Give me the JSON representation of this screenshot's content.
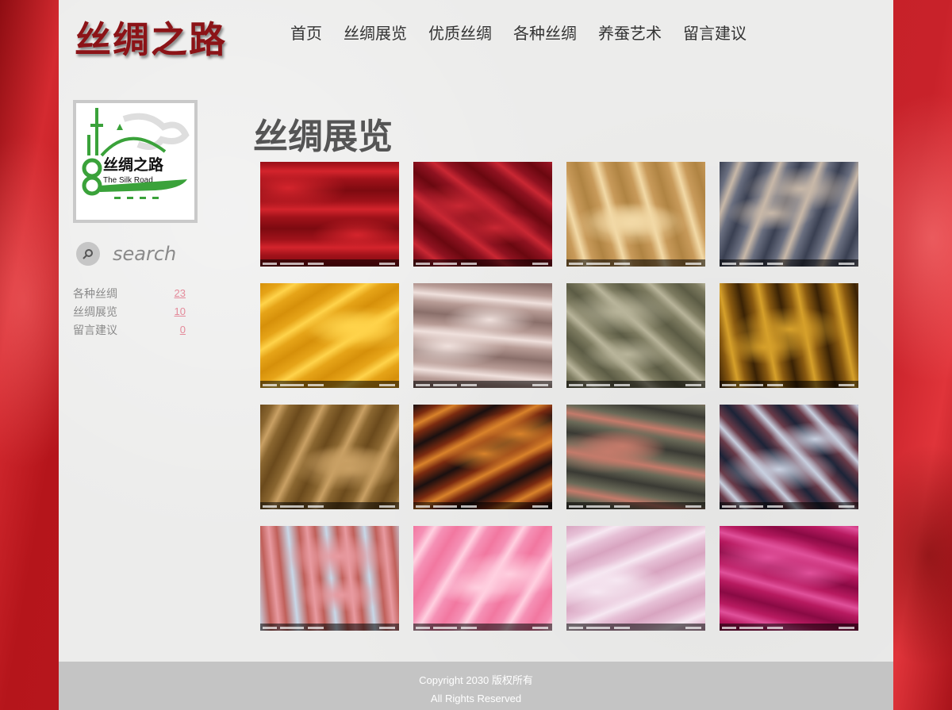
{
  "brand": {
    "title": "丝绸之路"
  },
  "nav": {
    "items": [
      {
        "label": "首页"
      },
      {
        "label": "丝绸展览"
      },
      {
        "label": "优质丝绸"
      },
      {
        "label": "各种丝绸"
      },
      {
        "label": "养蚕艺术"
      },
      {
        "label": "留言建议"
      }
    ]
  },
  "sidebar": {
    "logo": {
      "text_cn": "丝绸之路",
      "text_en": "The Silk Road"
    },
    "search": {
      "placeholder": "search"
    },
    "categories": [
      {
        "label": "各种丝绸",
        "count": "23"
      },
      {
        "label": "丝绸展览",
        "count": "10"
      },
      {
        "label": "留言建议",
        "count": "0"
      }
    ]
  },
  "main": {
    "title": "丝绸展览",
    "gallery": [
      {
        "name": "red-silk-1",
        "colors": [
          "#7d0a10",
          "#d4242c",
          "#a0121a"
        ]
      },
      {
        "name": "red-silk-2",
        "colors": [
          "#6b0810",
          "#c92733",
          "#8f1220"
        ]
      },
      {
        "name": "gold-ruffled-silk",
        "colors": [
          "#b08443",
          "#f2d9a6",
          "#c89a5a"
        ]
      },
      {
        "name": "grey-floral-silk",
        "colors": [
          "#3a4052",
          "#c8b8a8",
          "#6a6f80"
        ]
      },
      {
        "name": "yellow-floral-silk",
        "colors": [
          "#d6900a",
          "#ffd34a",
          "#e6a418"
        ]
      },
      {
        "name": "champagne-jacquard",
        "colors": [
          "#8a6f6a",
          "#efe0dc",
          "#b89c96"
        ]
      },
      {
        "name": "olive-silk",
        "colors": [
          "#5c5c45",
          "#b8b49a",
          "#7d7b60"
        ]
      },
      {
        "name": "bronze-satin",
        "colors": [
          "#3a2205",
          "#d6a02a",
          "#8a5a10"
        ]
      },
      {
        "name": "tan-jacquard",
        "colors": [
          "#6b4a1c",
          "#c9a064",
          "#8a6630"
        ]
      },
      {
        "name": "paisley-silk",
        "colors": [
          "#1a1010",
          "#d9822a",
          "#7a2a10"
        ]
      },
      {
        "name": "dark-rose-brocade",
        "colors": [
          "#3a3a34",
          "#c47a6a",
          "#6a6a58"
        ]
      },
      {
        "name": "blue-rose-satin",
        "colors": [
          "#1c2438",
          "#c8d0e0",
          "#6a3a48"
        ]
      },
      {
        "name": "pink-blossom-silk",
        "colors": [
          "#c8d8e8",
          "#e89aa0",
          "#c0605a"
        ]
      },
      {
        "name": "pink-satin",
        "colors": [
          "#f277a0",
          "#ffd0e0",
          "#f590b5"
        ]
      },
      {
        "name": "blush-satin",
        "colors": [
          "#d8a4c0",
          "#f6e8f2",
          "#e6c0d6"
        ]
      },
      {
        "name": "magenta-satin",
        "colors": [
          "#8a0a44",
          "#e0509a",
          "#b81a60"
        ]
      }
    ]
  },
  "footer": {
    "copyright": "Copyright 2030 版权所有",
    "rights": "All Rights Reserved"
  }
}
